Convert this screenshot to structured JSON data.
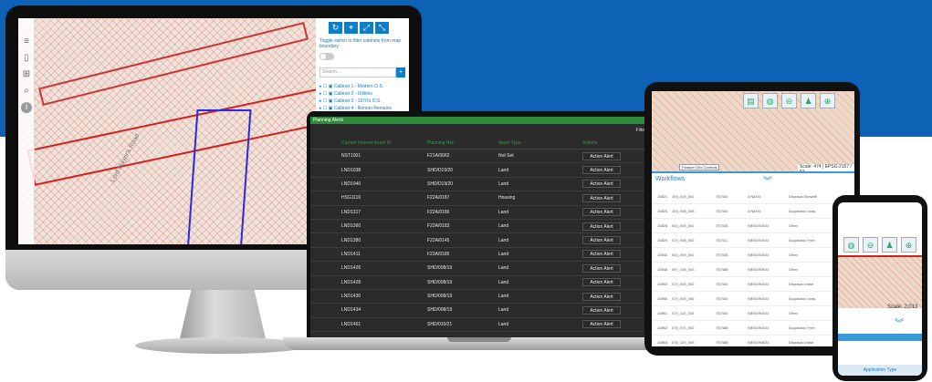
{
  "monitor": {
    "toolbar_icons": [
      "layers-icon",
      "bookmark-icon",
      "grid-icon",
      "search-icon",
      "info-icon"
    ],
    "toggle_text": "Toggle switch to filter cabinets from map boundary",
    "search_placeholder": "Search...",
    "search_button": "+",
    "cabinets": [
      "Cabinet 1 - Modern O.S.",
      "Cabinet 2 - Utilities",
      "Cabinet 3 - 1970's O.S.",
      "Cabinet 4 - Roman Remains"
    ],
    "street_label": "Lord Mayor's Road"
  },
  "laptop": {
    "header": "Planning Alerts",
    "filter_label": "Filte",
    "columns": [
      "Current Interest Asset Id",
      "Planning Ref",
      "Asset Type",
      "Actions"
    ],
    "rows": [
      {
        "id": "NST1001",
        "ref": "F21A/0662",
        "type": "Not Set",
        "action": "Action Alert"
      },
      {
        "id": "LND1038",
        "ref": "SHD/D19/20",
        "type": "Land",
        "action": "Action Alert"
      },
      {
        "id": "LND1040",
        "ref": "SHD/D19/20",
        "type": "Land",
        "action": "Action Alert"
      },
      {
        "id": "HSG1116",
        "ref": "F22A/0187",
        "type": "Housing",
        "action": "Action Alert"
      },
      {
        "id": "LND1317",
        "ref": "F22A/0186",
        "type": "Land",
        "action": "Action Alert"
      },
      {
        "id": "LND1360",
        "ref": "F22A/0183",
        "type": "Land",
        "action": "Action Alert"
      },
      {
        "id": "LND1380",
        "ref": "F22A/0145",
        "type": "Land",
        "action": "Action Alert"
      },
      {
        "id": "LND1411",
        "ref": "F22A/0185",
        "type": "Land",
        "action": "Action Alert"
      },
      {
        "id": "LND1426",
        "ref": "SHD/008/19",
        "type": "Land",
        "action": "Action Alert"
      },
      {
        "id": "LND1428",
        "ref": "SHD/008/19",
        "type": "Land",
        "action": "Action Alert"
      },
      {
        "id": "LND1430",
        "ref": "SHD/008/19",
        "type": "Land",
        "action": "Action Alert"
      },
      {
        "id": "LND1434",
        "ref": "SHD/008/19",
        "type": "Land",
        "action": "Action Alert"
      },
      {
        "id": "LND1461",
        "ref": "SHD/010/21",
        "type": "Land",
        "action": "Action Alert"
      }
    ]
  },
  "tablet": {
    "toolbar_icons": [
      "document-icon",
      "map-layer-icon",
      "zoom-out-icon",
      "person-icon",
      "zoom-in-icon"
    ],
    "map_controls_label": "Feature Grid Controls",
    "scale_text": "Scale: 474 | EPSG:2157 / 53",
    "workflows_label": "Workflows",
    "rows": [
      {
        "n": "10821",
        "a": "193_019_001",
        "b": "757400",
        "c": "4 N4/03",
        "d": "Disposal 'Brownfi'"
      },
      {
        "n": "10825",
        "a": "193_008_008",
        "b": "757400",
        "c": "4 N4/03",
        "d": "Acquisition Leas"
      },
      {
        "n": "10828",
        "a": "043_005_001",
        "b": "757335",
        "c": "WEB1915/24",
        "d": "Other"
      },
      {
        "n": "10829",
        "a": "074_008_002",
        "b": "757411",
        "c": "WEB1916/24",
        "d": "Acquisition Free"
      },
      {
        "n": "10845",
        "a": "043_009_001",
        "b": "757335",
        "c": "WEB1915/24",
        "d": "Other"
      },
      {
        "n": "10848",
        "a": "097_108_003",
        "b": "757488",
        "c": "WEB1905/24",
        "d": "Other"
      },
      {
        "n": "10853",
        "a": "074_005_002",
        "b": "757400",
        "c": "WEB1903/24",
        "d": "Disposal Lease"
      },
      {
        "n": "10856",
        "a": "074_005_006",
        "b": "757400",
        "c": "WEB1903/24",
        "d": "Acquisition Leas"
      },
      {
        "n": "10861",
        "a": "074_110_003",
        "b": "757400",
        "c": "WEB1903/24",
        "d": "Other"
      },
      {
        "n": "10862",
        "a": "075_075_002",
        "b": "757488",
        "c": "WEB1903/24",
        "d": "Acquisition Free"
      },
      {
        "n": "10864",
        "a": "075_120_005",
        "b": "757488",
        "c": "WEB1908/24",
        "d": "Disposal Lease"
      },
      {
        "n": "10866",
        "a": "101_225_002",
        "b": "757504",
        "c": "WEB1915/24",
        "d": "Acquisition Free"
      },
      {
        "n": "10867",
        "a": "101_215_003",
        "b": "757504",
        "c": "WEB1915/24",
        "d": "Other"
      }
    ]
  },
  "phone": {
    "toolbar_icons": [
      "map-layer-icon",
      "zoom-out-icon",
      "person-icon",
      "zoom-in-icon"
    ],
    "scale_text": "Scale: 2,013",
    "footer_label": "Application Type"
  }
}
